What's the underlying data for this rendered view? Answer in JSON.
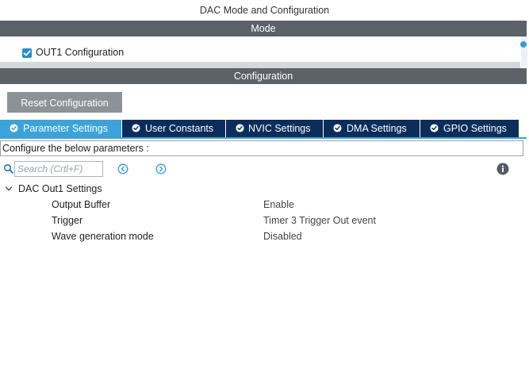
{
  "window": {
    "title": "DAC Mode and Configuration"
  },
  "mode": {
    "header": "Mode",
    "out1": {
      "label": "OUT1 Configuration",
      "checked": true
    }
  },
  "configuration": {
    "header": "Configuration",
    "reset_label": "Reset Configuration",
    "tabs": [
      {
        "label": "Parameter Settings",
        "active": true,
        "icon": "check-circle-icon"
      },
      {
        "label": "User Constants",
        "active": false,
        "icon": "check-circle-icon"
      },
      {
        "label": "NVIC Settings",
        "active": false,
        "icon": "check-circle-icon"
      },
      {
        "label": "DMA Settings",
        "active": false,
        "icon": "check-circle-icon"
      },
      {
        "label": "GPIO Settings",
        "active": false,
        "icon": "check-circle-icon"
      }
    ],
    "description": "Configure the below parameters :",
    "search": {
      "placeholder": "Search (Crtl+F)",
      "value": ""
    },
    "group": {
      "label": "DAC Out1 Settings",
      "params": [
        {
          "name": "Output Buffer",
          "value": "Enable"
        },
        {
          "name": "Trigger",
          "value": "Timer 3 Trigger Out event"
        },
        {
          "name": "Wave generation mode",
          "value": "Disabled"
        }
      ]
    }
  },
  "colors": {
    "section_bar": "#5c6268",
    "tab_inactive": "#0b2d5b",
    "tab_active": "#3aa3d9",
    "checkbox": "#1f8fd6",
    "reset_button": "#8c9398"
  }
}
